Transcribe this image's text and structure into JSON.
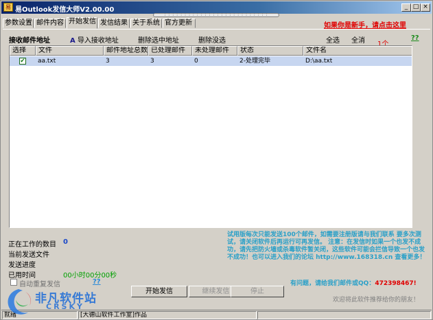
{
  "window": {
    "title": "易Outlook发信大师V2.00.00",
    "app_icon": "易"
  },
  "window_buttons": {
    "minimize": "_",
    "maximize": "□",
    "close": "×"
  },
  "tabs": [
    {
      "label": "参数设置"
    },
    {
      "label": "邮件内容"
    },
    {
      "label": "开始发信"
    },
    {
      "label": "发信结果"
    },
    {
      "label": "关于系统"
    },
    {
      "label": "官方更新"
    }
  ],
  "header_hint": "如果你是新手，请点击这里",
  "toolbar": {
    "recv_label": "接收邮件地址",
    "import_icon": "A",
    "import": "导入接收地址",
    "delete_selected": "删除选中地址",
    "delete_unselected": "删除没选",
    "select_all": "全选",
    "clear": "全消",
    "count": "1个",
    "help": "??"
  },
  "list": {
    "columns": [
      "选择",
      "文件",
      "邮件地址总数",
      "已处理邮件",
      "未处理邮件",
      "状态",
      "文件名"
    ],
    "rows": [
      {
        "checked": "✔",
        "file": "aa.txt",
        "total": "3",
        "done": "3",
        "pending": "0",
        "state": "2-处理完毕",
        "path": "D:\\aa.txt"
      }
    ]
  },
  "status": {
    "working_count_label": "正在工作的数目",
    "working_count": "0",
    "current_file_label": "当前发送文件",
    "progress_label": "发送进度",
    "elapsed_label": "已用时间",
    "elapsed": "00小时00分00秒",
    "auto_resend": "自动重复发信",
    "auto_help": "??"
  },
  "notice": "试用版每次只能发送100个邮件，如需要注册版请与我们联系 要多次测试，请关闭软件后再运行可再发信。 注意：在发信时如果一个也发不成功，请先把防火墙或杀毒软件暂关闭，这些软件可能会拦信导致一个也发不成功！也可以进入我们的论坛 http://www.168318.cn 查看更多！",
  "contact": {
    "text": "有问题，请给我们邮件或QQ：",
    "qq": "472398467!"
  },
  "buttons": {
    "start": "开始发信",
    "continue": "继续发信",
    "stop": "停止"
  },
  "welcome": "欢迎将此软件推荐给你的朋友！",
  "statusbar": {
    "left": "就绪",
    "studio": "[大德山软件工作室]作品"
  },
  "watermark": {
    "text": "非凡软件站",
    "sub": "CRSKY"
  }
}
